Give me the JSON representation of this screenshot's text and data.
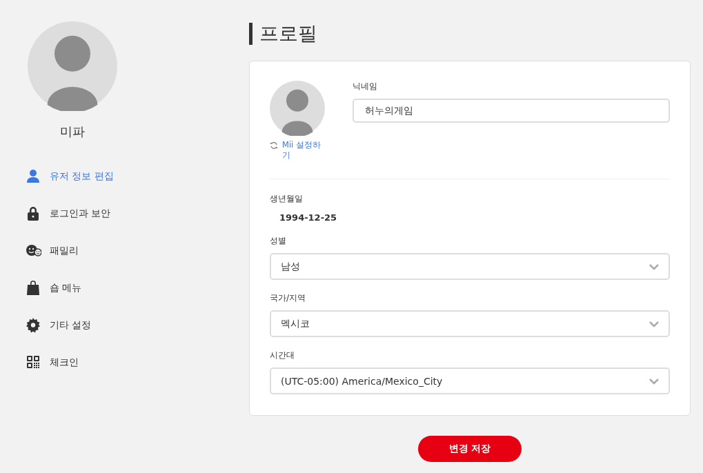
{
  "user": {
    "name": "미파"
  },
  "sidebar": {
    "items": [
      {
        "label": "유저 정보 편집",
        "kind": "person",
        "selected": true
      },
      {
        "label": "로그인과 보안",
        "kind": "lock",
        "selected": false
      },
      {
        "label": "패밀리",
        "kind": "family",
        "selected": false
      },
      {
        "label": "숍 메뉴",
        "kind": "bag",
        "selected": false
      },
      {
        "label": "기타 설정",
        "kind": "gear",
        "selected": false
      },
      {
        "label": "체크인",
        "kind": "qr",
        "selected": false
      }
    ]
  },
  "page": {
    "title": "프로필"
  },
  "profile": {
    "mii_link": "Mii 설정하기",
    "nickname": {
      "label": "닉네임",
      "value": "허누의게임"
    },
    "fields": [
      {
        "kind": "text",
        "label": "생년월일",
        "value": "1994-12-25"
      },
      {
        "kind": "select",
        "label": "성별",
        "value": "남성"
      },
      {
        "kind": "select",
        "label": "국가/지역",
        "value": "멕시코"
      },
      {
        "kind": "select",
        "label": "시간대",
        "value": "(UTC-05:00) America/Mexico_City"
      }
    ]
  },
  "save_button": "변경 저장"
}
